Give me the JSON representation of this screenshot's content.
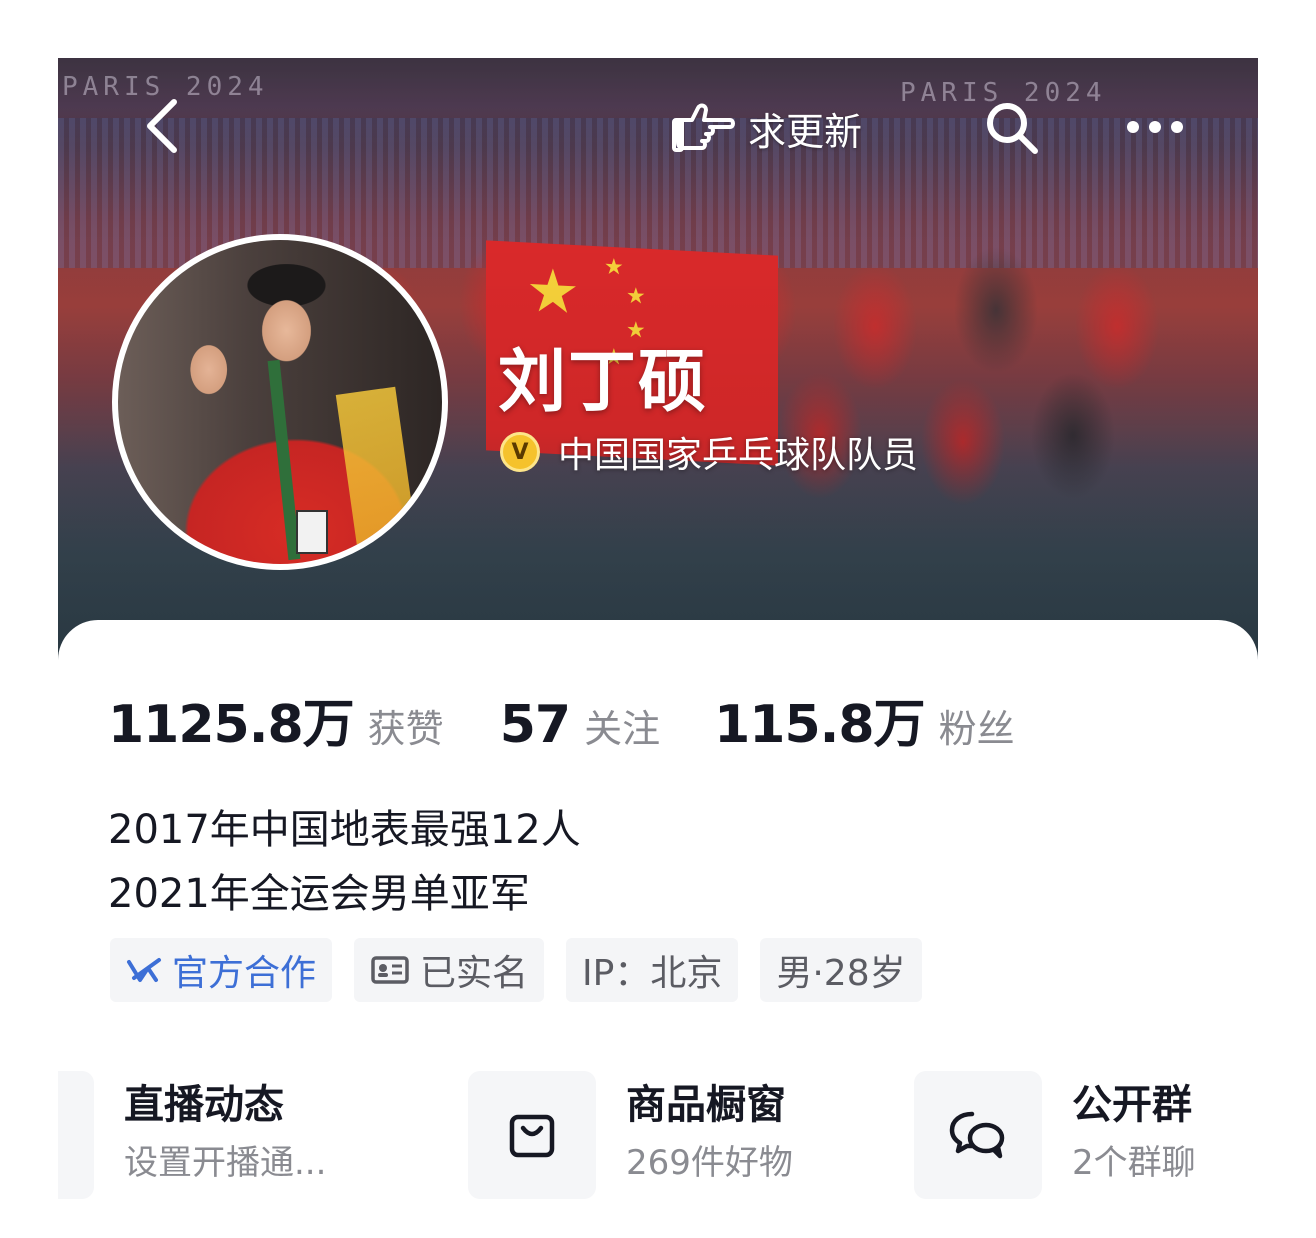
{
  "header": {
    "back_icon": "chevron-left-icon",
    "update_icon": "pointing-hand-icon",
    "update_label": "求更新",
    "search_icon": "search-icon",
    "more_icon": "more-dots-icon",
    "banner_text_left": "PARIS 2024",
    "banner_text_right": "PARIS 2024"
  },
  "profile": {
    "name": "刘丁硕",
    "verified_badge": "V",
    "verified_title": "中国国家乒乓球队队员"
  },
  "stats": [
    {
      "value": "1125.8万",
      "label": "获赞"
    },
    {
      "value": "57",
      "label": "关注"
    },
    {
      "value": "115.8万",
      "label": "粉丝"
    }
  ],
  "bio": [
    "2017年中国地表最强12人",
    "2021年全运会男单亚军"
  ],
  "tags": {
    "official": "官方合作",
    "real_name": "已实名",
    "ip": "IP：北京",
    "gender_age": "男·28岁"
  },
  "services": [
    {
      "title": "直播动态",
      "subtitle": "设置开播通...",
      "icon": "live-icon"
    },
    {
      "title": "商品橱窗",
      "subtitle": "269件好物",
      "icon": "shopping-bag-icon"
    },
    {
      "title": "公开群",
      "subtitle": "2个群聊",
      "icon": "chat-bubbles-icon"
    }
  ],
  "colors": {
    "accent_blue": "#3d6fd6",
    "badge_gold": "#f5c22c",
    "text_primary": "#161823",
    "text_secondary": "#8a8b91"
  }
}
